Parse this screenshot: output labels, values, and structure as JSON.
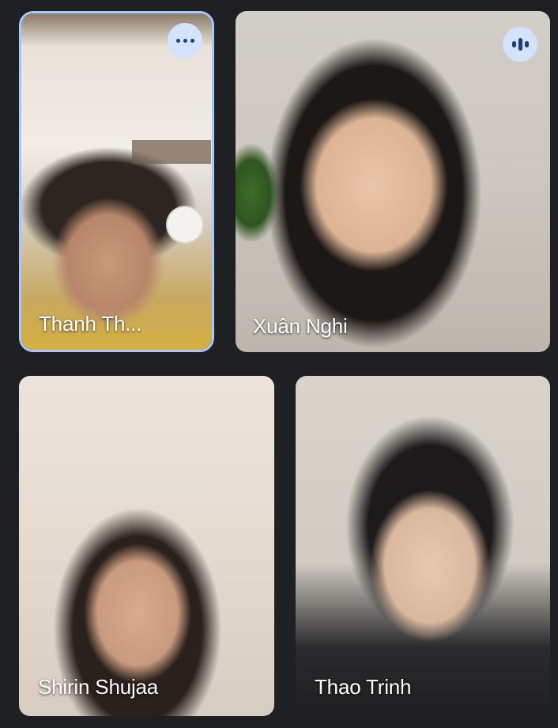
{
  "participants": [
    {
      "name": "Thanh Th...",
      "state": "pinned-focus",
      "menu_icon": "more-horizontal-icon"
    },
    {
      "name": "Xuân Nghi",
      "state": "speaking",
      "status_icon": "audio-level-icon"
    },
    {
      "name": "Shirin Shujaa"
    },
    {
      "name": "Thao Trinh"
    }
  ],
  "colors": {
    "background": "#1f2023",
    "focus_border": "#a8c7fa",
    "badge_bg": "#d3e3fd",
    "badge_fg": "#1f3d78"
  }
}
